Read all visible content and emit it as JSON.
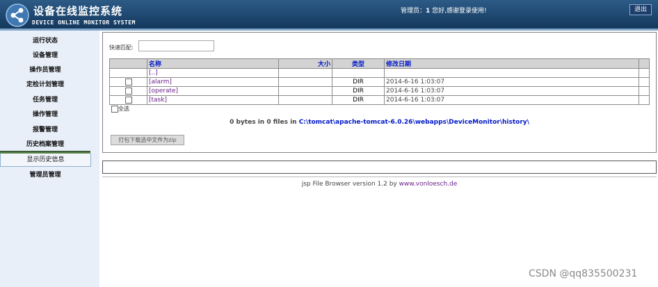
{
  "header": {
    "title": "设备在线监控系统",
    "subtitle": "DEVICE ONLINE MONITOR SYSTEM",
    "welcome_prefix": "管理员：",
    "welcome_user": "1",
    "welcome_suffix": "您好,感谢登录使用!",
    "logout_label": "退出"
  },
  "sidebar": {
    "items": [
      {
        "label": "运行状态"
      },
      {
        "label": "设备管理"
      },
      {
        "label": "操作员管理"
      },
      {
        "label": "定检计划管理"
      },
      {
        "label": "任务管理"
      },
      {
        "label": "操作管理"
      },
      {
        "label": "报警管理"
      },
      {
        "label": "历史档案管理"
      }
    ],
    "sub_item": "显示历史信息",
    "last_item": "管理员管理"
  },
  "browser": {
    "quick_match_label": "快速匹配:",
    "quick_match_value": "",
    "columns": [
      "名称",
      "大小",
      "类型",
      "修改日期"
    ],
    "parent_link": "[..]",
    "rows": [
      {
        "name": "[alarm]",
        "size": "",
        "type": "DIR",
        "date": "2014-6-16 1:03:07"
      },
      {
        "name": "[operate]",
        "size": "",
        "type": "DIR",
        "date": "2014-6-16 1:03:07"
      },
      {
        "name": "[task]",
        "size": "",
        "type": "DIR",
        "date": "2014-6-16 1:03:07"
      }
    ],
    "select_all_label": "全选",
    "status_text": "0 bytes in 0 files in ",
    "status_path": "C:\\tomcat\\apache-tomcat-6.0.26\\webapps\\DeviceMonitor\\history\\",
    "zip_button_label": "打包下载选中文件为zip"
  },
  "footer": {
    "text": "jsp File Browser version 1.2 by ",
    "link": "www.vonloesch.de"
  },
  "watermark": "CSDN @qq835500231",
  "colors": {
    "header_bg": "#1d4670",
    "sidebar_bg": "#e8eff8",
    "link_blue": "#0018c8",
    "link_purple": "#6a1f8a"
  }
}
